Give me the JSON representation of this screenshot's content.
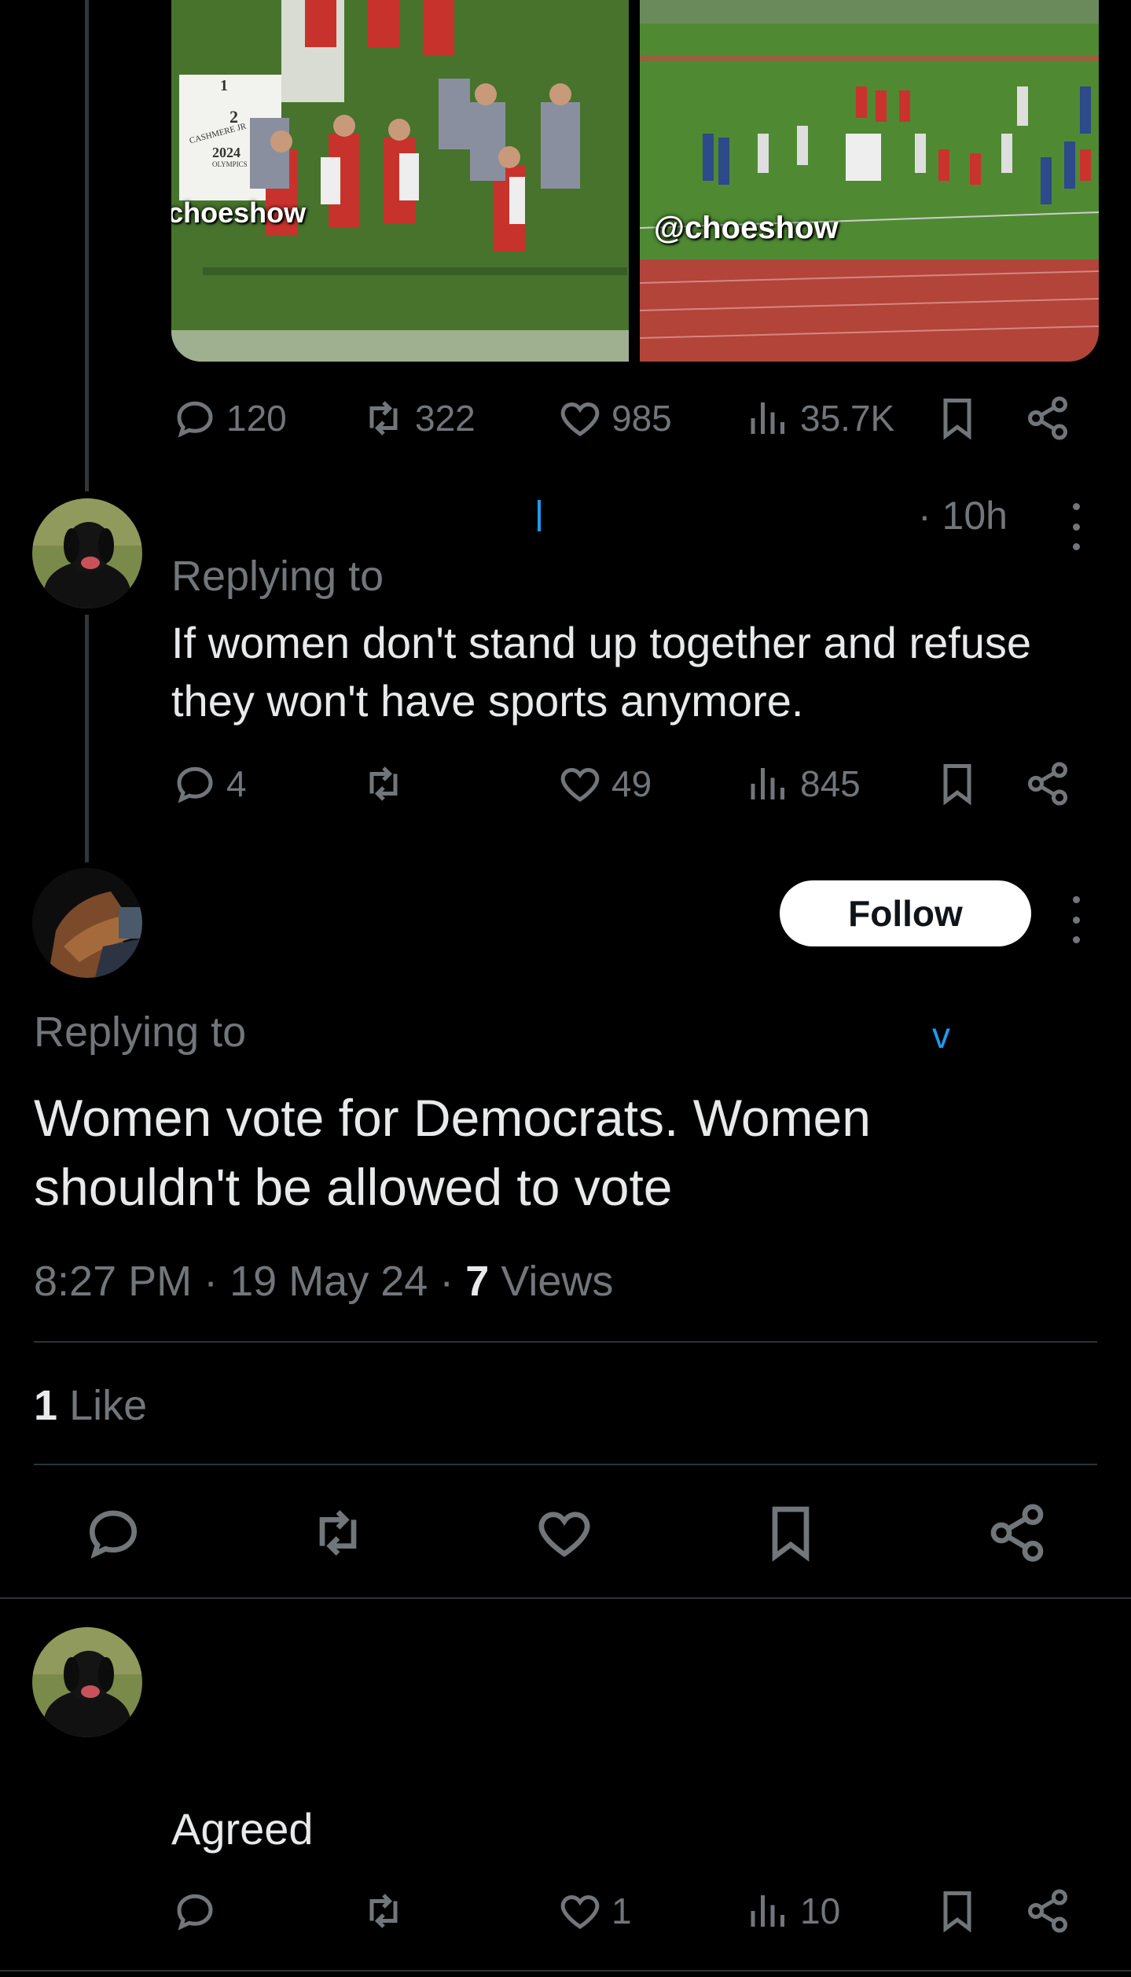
{
  "media": {
    "left_watermark": "@choeshow",
    "right_watermark": "@choeshow",
    "podium_sign": {
      "place": "2",
      "text": "CASHMERE JR",
      "year": "2024",
      "sub": "OLYMPICS",
      "first_place": "1"
    }
  },
  "post1": {
    "actions": {
      "replies": "120",
      "reposts": "322",
      "likes": "985",
      "views": "35.7K"
    }
  },
  "reply1": {
    "time": "· 10h",
    "replying_to": "Replying to",
    "text_line1": "If women don't stand up together and refuse",
    "text_line2": "they won't have sports anymore.",
    "actions": {
      "replies": "4",
      "reposts": "",
      "likes": "49",
      "views": "845"
    }
  },
  "main_post": {
    "follow_label": "Follow",
    "replying_to": "Replying to",
    "text_line1": "Women vote for Democrats.  Women",
    "text_line2": "shouldn't be allowed to vote",
    "time": "8:27 PM",
    "date": "19 May 24",
    "views_count": "7",
    "views_label": "Views",
    "likes_count": "1",
    "likes_label": "Like"
  },
  "reply2": {
    "text": "Agreed",
    "actions": {
      "replies": "",
      "reposts": "",
      "likes": "1",
      "views": "10"
    }
  },
  "colors": {
    "background": "#000000",
    "text": "#e7e9ea",
    "muted": "#71767b",
    "divider": "#2f3336",
    "link": "#1d9bf0"
  }
}
